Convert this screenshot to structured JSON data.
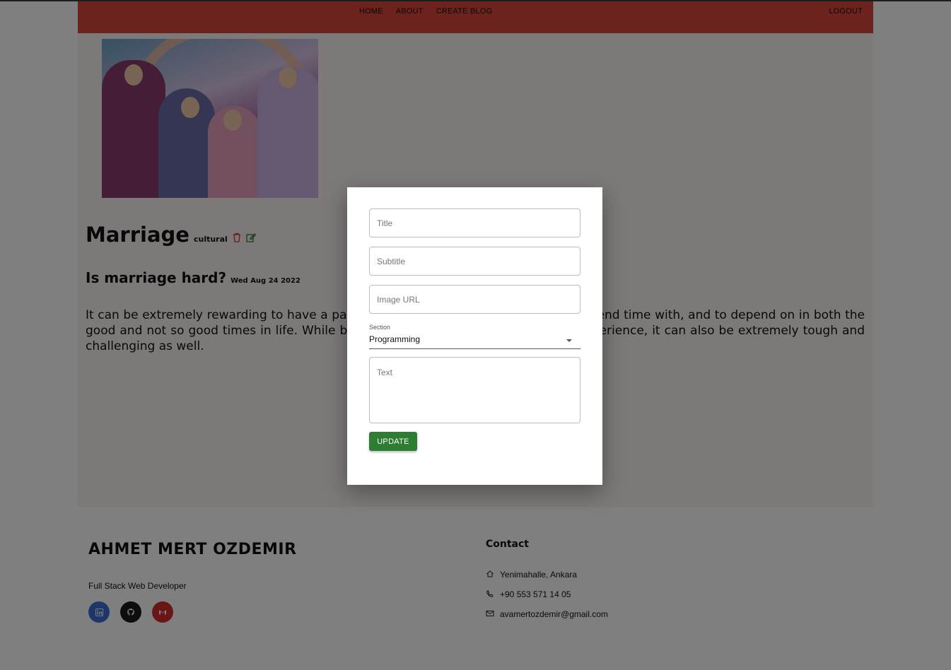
{
  "nav": {
    "links": [
      "HOME",
      "ABOUT",
      "CREATE BLOG"
    ],
    "logout": "LOGOUT",
    "color": "#d8453a"
  },
  "post": {
    "title": "Marriage",
    "section": "cultural",
    "subtitle": "Is marriage hard?",
    "date": "Wed Aug 24 2022",
    "text": "It can be extremely rewarding to have a partner in life, someone to laugh with, to spend time with, and to depend on in both the good and not so good times in life. While being in a marriage can be a beautiful experience, it can also be extremely tough and challenging as well.",
    "delete_icon": "trash-icon",
    "edit_icon": "edit-icon"
  },
  "footer": {
    "name": "AHMET MERT OZDEMIR",
    "tagline": "Full Stack Web Developer",
    "socials": [
      "linkedin-icon",
      "github-icon",
      "gmail-icon"
    ],
    "contact_title": "Contact",
    "address": "Yenimahalle, Ankara",
    "phone": "+90 553 571 14 05",
    "email": "avamertozdemir@gmail.com"
  },
  "modal": {
    "title_placeholder": "Title",
    "subtitle_placeholder": "Subtitle",
    "image_placeholder": "Image URL",
    "section_label": "Section",
    "section_value": "Programming",
    "text_placeholder": "Text",
    "update_label": "UPDATE",
    "button_color": "#2e7d32"
  }
}
